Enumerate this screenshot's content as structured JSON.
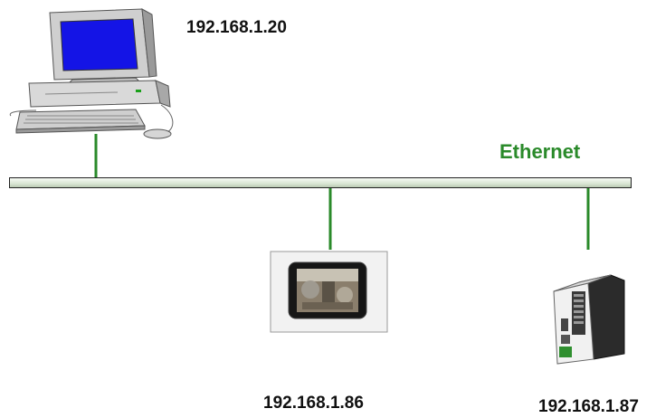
{
  "network": {
    "label": "Ethernet",
    "color": "#2a8a2a"
  },
  "devices": {
    "pc": {
      "ip": "192.168.1.20",
      "icon": "desktop-computer-icon"
    },
    "touch_panel": {
      "ip": "192.168.1.86",
      "icon": "touch-panel-hmi-icon"
    },
    "plc": {
      "ip": "192.168.1.87",
      "icon": "plc-controller-icon"
    }
  }
}
